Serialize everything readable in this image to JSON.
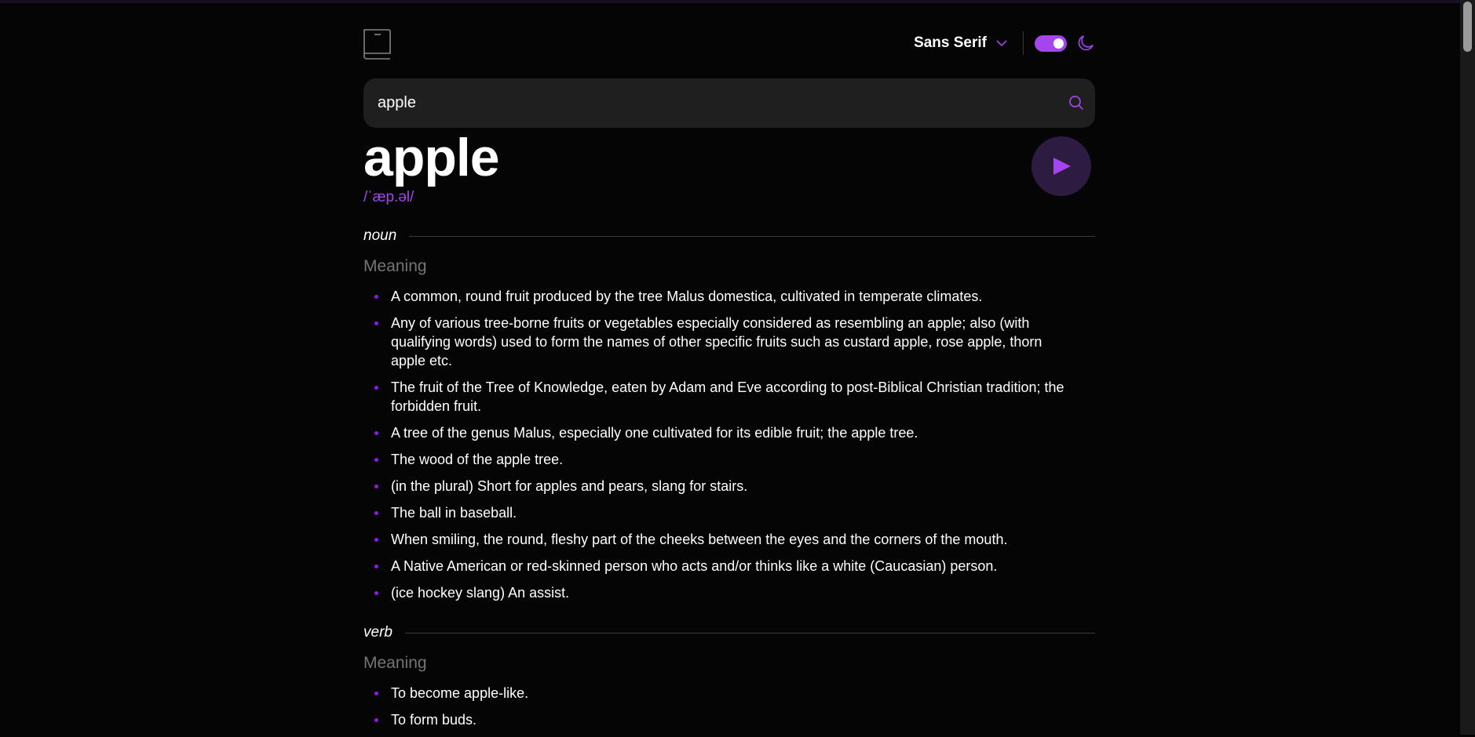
{
  "header": {
    "font_selector": "Sans Serif",
    "theme_toggle_on": true
  },
  "search": {
    "value": "apple",
    "placeholder": ""
  },
  "entry": {
    "word": "apple",
    "phonetic": "/ˈæp.əl/",
    "meanings": [
      {
        "part_of_speech": "noun",
        "meaning_label": "Meaning",
        "definitions": [
          "A common, round fruit produced by the tree Malus domestica, cultivated in temperate climates.",
          "Any of various tree-borne fruits or vegetables especially considered as resembling an apple; also (with qualifying words) used to form the names of other specific fruits such as custard apple, rose apple, thorn apple etc.",
          "The fruit of the Tree of Knowledge, eaten by Adam and Eve according to post-Biblical Christian tradition; the forbidden fruit.",
          "A tree of the genus Malus, especially one cultivated for its edible fruit; the apple tree.",
          "The wood of the apple tree.",
          "(in the plural) Short for apples and pears, slang for stairs.",
          "The ball in baseball.",
          "When smiling, the round, fleshy part of the cheeks between the eyes and the corners of the mouth.",
          "A Native American or red-skinned person who acts and/or thinks like a white (Caucasian) person.",
          "(ice hockey slang) An assist."
        ]
      },
      {
        "part_of_speech": "verb",
        "meaning_label": "Meaning",
        "definitions": [
          "To become apple-like.",
          "To form buds."
        ]
      }
    ]
  },
  "colors": {
    "accent": "#a445ed",
    "background": "#050505",
    "surface": "#1f1f1f",
    "muted": "#757575",
    "play_bg": "#2e1b41"
  },
  "icons": {
    "logo": "book-icon",
    "dropdown": "chevron-down-icon",
    "theme": "moon-icon",
    "search": "search-icon",
    "play": "play-icon"
  }
}
